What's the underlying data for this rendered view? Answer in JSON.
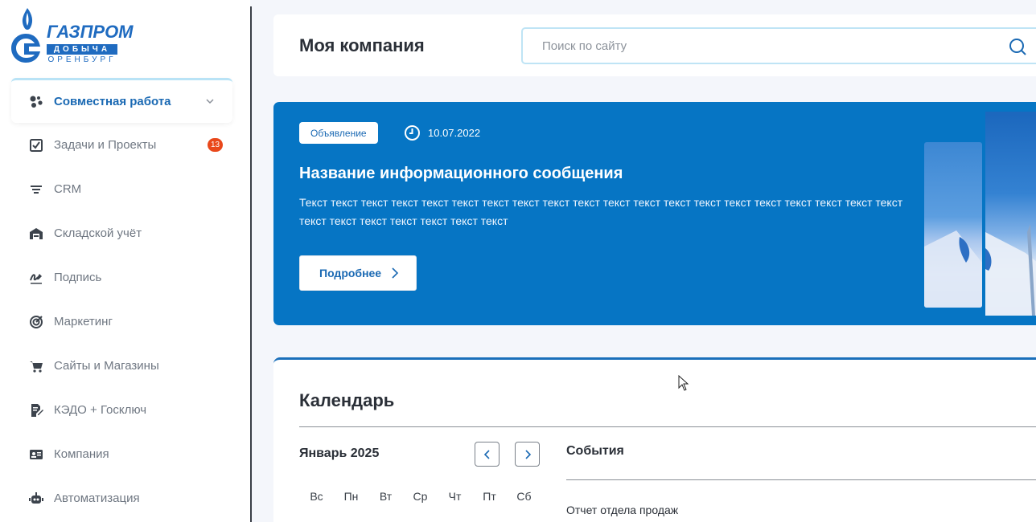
{
  "logo": {
    "line1": "ГАЗПРОМ",
    "line2": "ДОБЫЧА",
    "line3": "ОРЕНБУРГ",
    "brand_color": "#1f6bc0"
  },
  "sidebar": {
    "items": [
      {
        "label": "Совместная работа",
        "icon": "collaboration-icon",
        "active": true
      },
      {
        "label": "Задачи и Проекты",
        "icon": "tasks-icon",
        "badge": "13"
      },
      {
        "label": "CRM",
        "icon": "crm-filter-icon"
      },
      {
        "label": "Складской учёт",
        "icon": "warehouse-icon"
      },
      {
        "label": "Подпись",
        "icon": "signature-icon"
      },
      {
        "label": "Маркетинг",
        "icon": "target-icon"
      },
      {
        "label": "Сайты и Магазины",
        "icon": "cart-icon"
      },
      {
        "label": "КЭДО + Госключ",
        "icon": "document-edit-icon"
      },
      {
        "label": "Компания",
        "icon": "id-card-icon"
      },
      {
        "label": "Автоматизация",
        "icon": "robot-icon"
      }
    ]
  },
  "header": {
    "title": "Моя компания",
    "search_placeholder": "Поиск по сайту"
  },
  "banner": {
    "badge": "Объявление",
    "date": "10.07.2022",
    "title": "Название информационного сообщения",
    "text": "Текст текст текст текст текст текст текст текст текст текст текст текст текст текст текст текст текст текст текст текст текст текст текст текст текст текст текст",
    "button_label": "Подробнее",
    "background_color": "#0675c4"
  },
  "calendar": {
    "title": "Календарь",
    "month": "Январь 2025",
    "weekdays": [
      "Вс",
      "Пн",
      "Вт",
      "Ср",
      "Чт",
      "Пт",
      "Сб"
    ],
    "events_title": "События",
    "events": [
      "Отчет отдела продаж"
    ]
  },
  "colors": {
    "accent": "#1a69b3",
    "badge_red": "#e9481b"
  }
}
